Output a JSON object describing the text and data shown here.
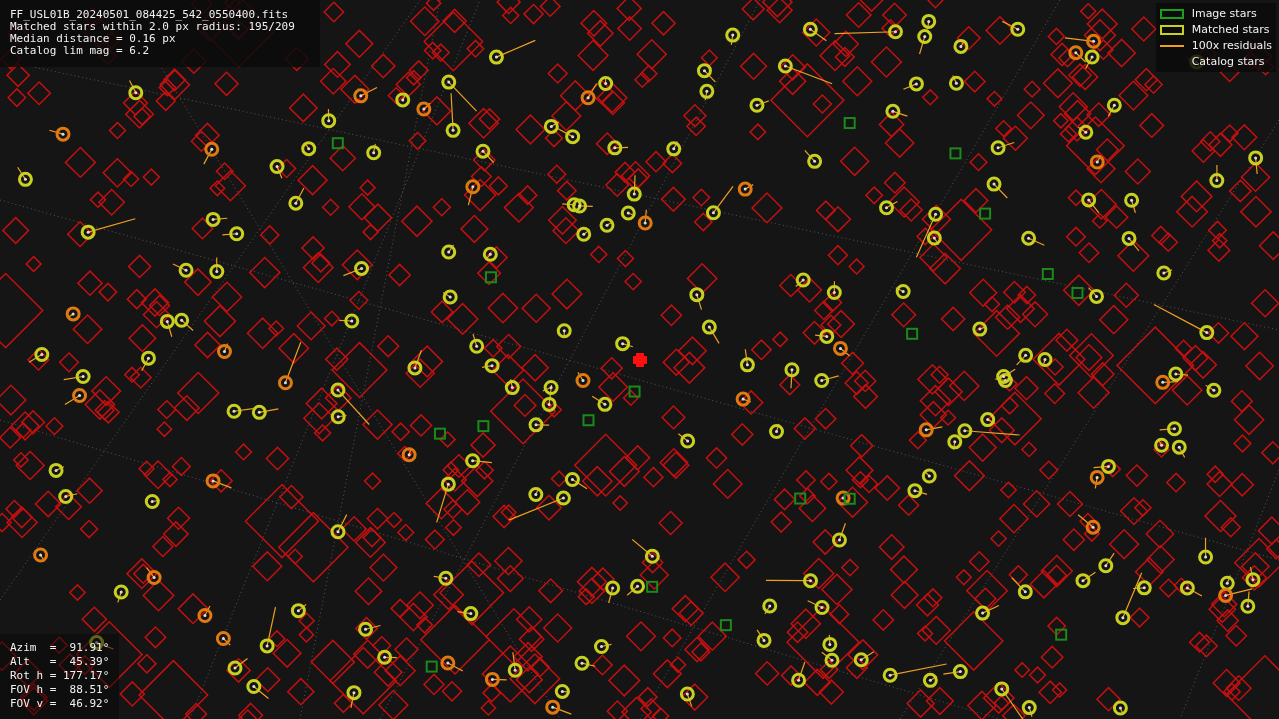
{
  "header": {
    "lines": [
      "FF_USL01B_20240501_084425_542_0550400.fits",
      "Matched stars within 2.0 px radius: 195/209",
      "Median distance = 0.16 px",
      "Catalog lim mag = 6.2"
    ]
  },
  "legend": [
    {
      "kind": "image",
      "label": "Image stars"
    },
    {
      "kind": "matched",
      "label": "Matched stars"
    },
    {
      "kind": "residual",
      "label": "100x residuals"
    },
    {
      "kind": "catalog",
      "label": "Catalog stars"
    }
  ],
  "pointing": {
    "lines": [
      "Azim  =  91.91°",
      "Alt   =  45.39°",
      "Rot h = 177.17°",
      "FOV h =  88.51°",
      "FOV v =  46.92°"
    ]
  }
}
